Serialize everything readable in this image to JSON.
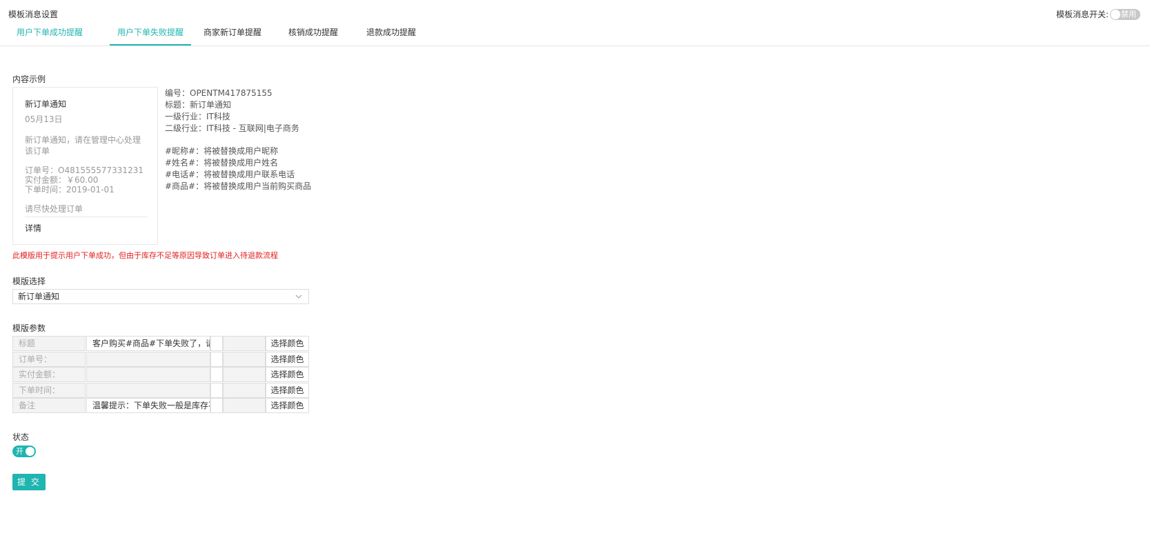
{
  "page_title": "模板消息设置",
  "switch": {
    "label": "模板消息开关:",
    "state": "禁用"
  },
  "tabs": [
    {
      "label": "用户下单成功提醒"
    },
    {
      "label": "用户下单失败提醒",
      "active": true
    },
    {
      "label": "商家新订单提醒"
    },
    {
      "label": "核销成功提醒"
    },
    {
      "label": "退款成功提醒"
    }
  ],
  "example": {
    "section_label": "内容示例",
    "card": {
      "title": "新订单通知",
      "date": "05月13日",
      "body": "新订单通知，请在管理中心处理该订单",
      "order_no": "订单号：O481555577331231",
      "amount": "实付金额：￥60.00",
      "time": "下单时间：2019-01-01",
      "note": "请尽快处理订单",
      "detail": "详情"
    },
    "info": [
      "编号：OPENTM417875155",
      "标题：新订单通知",
      "一级行业：IT科技",
      "二级行业：IT科技 - 互联网|电子商务",
      "#昵称#：将被替换成用户昵称",
      "#姓名#：将被替换成用户姓名",
      "#电话#：将被替换成用户联系电话",
      "#商品#：将被替换成用户当前购买商品"
    ]
  },
  "warning": "此模版用于提示用户下单成功，但由于库存不足等原因导致订单进入待退款流程",
  "template_select": {
    "label": "模版选择",
    "value": "新订单通知"
  },
  "params": {
    "label": "模版参数",
    "color_button_label": "选择颜色",
    "rows": [
      {
        "label": "标题",
        "value": "客户购买#商品#下单失败了，请及时处理"
      },
      {
        "label": "订单号：",
        "value": ""
      },
      {
        "label": "实付金额：",
        "value": ""
      },
      {
        "label": "下单时间：",
        "value": ""
      },
      {
        "label": "备注",
        "value": "温馨提示：下单失败一般是库存不足"
      }
    ]
  },
  "status": {
    "label": "状态",
    "toggle_label": "开"
  },
  "submit_label": "提 交",
  "colors": {
    "accent": "#1fb5b0",
    "warning": "#e02020",
    "border": "#dddddd",
    "muted_bg": "#f3f3f3"
  }
}
